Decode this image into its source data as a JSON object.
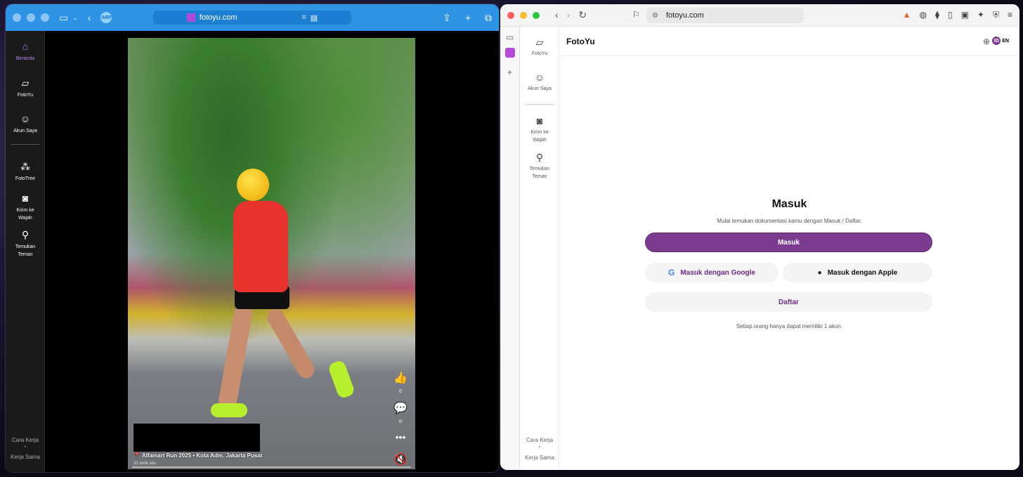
{
  "left_window": {
    "url": "fotoyu.com",
    "avatar_initials": "ARP",
    "sidebar": [
      {
        "label": "Beranda",
        "icon": "home-icon",
        "glyph": "⌂"
      },
      {
        "label": "FotoYu",
        "icon": "fotoyu-logo-icon",
        "glyph": "▱"
      },
      {
        "label": "Akun Saya",
        "icon": "user-icon",
        "glyph": "☺"
      },
      {
        "label": "FotoTree",
        "icon": "tree-icon",
        "glyph": "⁂"
      },
      {
        "label": "Kirim ke Wajah",
        "icon": "face-send-icon",
        "glyph": "◙"
      },
      {
        "label": "Temukan Teman",
        "icon": "find-friend-icon",
        "glyph": "⚲"
      }
    ],
    "footer": {
      "how_it_works": "Cara Kerja",
      "dot": "•",
      "partnership": "Kerja Sama"
    },
    "post": {
      "location": "Alfamart Run 2025 • Kota Adm. Jakarta Pusat",
      "time_ago": "33 detik lalu",
      "likes": "0",
      "comments": "0"
    }
  },
  "right_window": {
    "url": "fotoyu.com",
    "header_title": "FotoYu",
    "lang_id": "ID",
    "lang_en": "EN",
    "sidebar": [
      {
        "label": "FotoYu",
        "icon": "fotoyu-logo-icon",
        "glyph": "▱"
      },
      {
        "label": "Akun Saya",
        "icon": "user-icon",
        "glyph": "☺"
      },
      {
        "label": "Kirim ke Wajah",
        "icon": "face-send-icon",
        "glyph": "◙"
      },
      {
        "label": "Temukan Teman",
        "icon": "find-friend-icon",
        "glyph": "⚲"
      }
    ],
    "footer": {
      "how_it_works": "Cara Kerja",
      "dot": "•",
      "partnership": "Kerja Sama"
    },
    "login": {
      "title": "Masuk",
      "subtitle": "Mulai temukan dokumentasi kamu dengan Masuk / Daftar.",
      "primary_button": "Masuk",
      "google_button": "Masuk dengan Google",
      "apple_button": "Masuk dengan Apple",
      "register_button": "Daftar",
      "note": "Setiap orang hanya dapat memiliki 1 akun."
    }
  },
  "colors": {
    "safari_toolbar": "#2e93e4",
    "brand_purple": "#7b3c8f",
    "active_nav": "#b883e8"
  }
}
